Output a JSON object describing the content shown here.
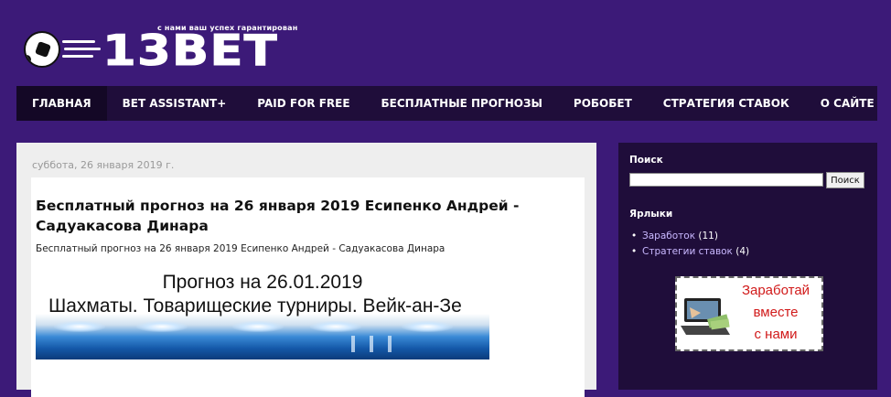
{
  "header": {
    "brand": "13BET",
    "slogan": "с нами ваш успех гарантирован"
  },
  "nav": {
    "items": [
      {
        "label": "ГЛАВНАЯ"
      },
      {
        "label": "BET ASSISTANT+"
      },
      {
        "label": "PAID FOR FREE"
      },
      {
        "label": "БЕСПЛАТНЫЕ ПРОГНОЗЫ"
      },
      {
        "label": "РОБОБЕТ"
      },
      {
        "label": "СТРАТЕГИЯ СТАВОК"
      },
      {
        "label": "О САЙТЕ"
      }
    ],
    "active": "ГЛАВНАЯ"
  },
  "post": {
    "date": "суббота, 26 января 2019 г.",
    "title": "Бесплатный прогноз на 26 января 2019 Есипенко Андрей - Садуакасова Динара",
    "subtitle": "Бесплатный прогноз на 26 января 2019 Есипенко Андрей - Садуакасова Динара",
    "banner": {
      "line1": "Прогноз на 26.01.2019",
      "line2": "Шахматы. Товарищеские турниры. Вейк-ан-Зе"
    }
  },
  "sidebar": {
    "search": {
      "title": "Поиск",
      "button": "Поиск",
      "value": ""
    },
    "labels": {
      "title": "Ярлыки",
      "items": [
        {
          "name": "Заработок",
          "count": "(11)"
        },
        {
          "name": "Стратегии ставок",
          "count": "(4)"
        }
      ]
    },
    "ad": {
      "line1": "Заработай",
      "line2": "вместе",
      "line3": "с нами"
    }
  },
  "colors": {
    "background": "#3c1a78",
    "nav": "#1f0d3a",
    "ad_text": "#d11a1a"
  }
}
